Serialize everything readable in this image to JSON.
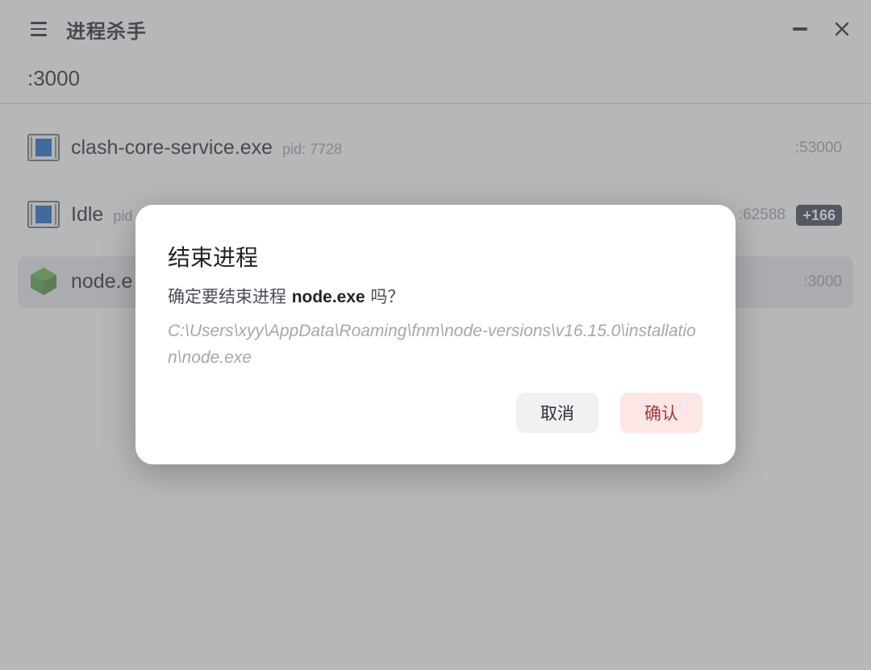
{
  "app": {
    "title": "进程杀手",
    "search_value": ":3000",
    "search_placeholder": ""
  },
  "processes": [
    {
      "name": "clash-core-service.exe",
      "pid": "pid: 7728",
      "port": ":53000",
      "badge": ""
    },
    {
      "name": "Idle",
      "pid": "pid",
      "port": ":62588",
      "badge": "+166"
    },
    {
      "name": "node.e",
      "pid": "",
      "port": ":3000",
      "badge": ""
    }
  ],
  "dialog": {
    "title": "结束进程",
    "message_prefix": "确定要结束进程",
    "message_process": "node.exe",
    "message_suffix": "吗？",
    "path": "C:\\Users\\xyy\\AppData\\Roaming\\fnm\\node-versions\\v16.15.0\\installation\\node.exe",
    "cancel_label": "取消",
    "confirm_label": "确认"
  },
  "icons": {
    "menu": "hamburger-menu-icon",
    "minimize": "minimize-icon",
    "close": "close-icon",
    "app_window": "app-window-icon",
    "node": "nodejs-hexagon-icon"
  },
  "colors": {
    "badge_bg": "#394150",
    "confirm_bg": "#fde6e6",
    "confirm_text": "#a33b38",
    "node_green": "#539e43"
  }
}
